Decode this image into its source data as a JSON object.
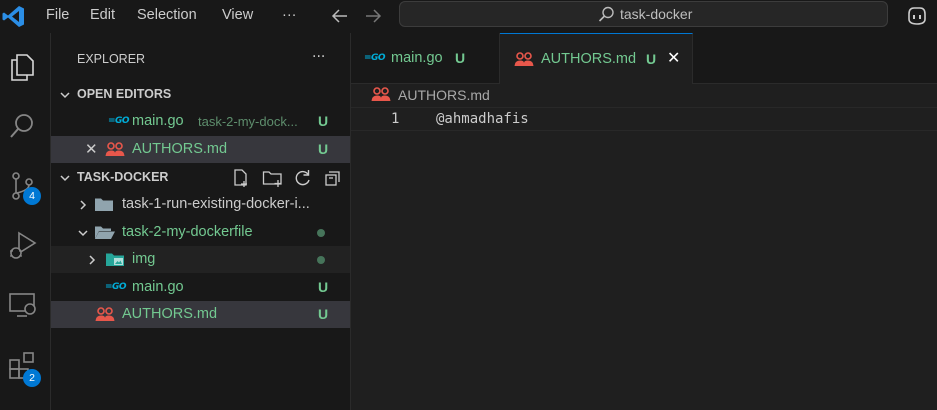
{
  "menu": {
    "file": "File",
    "edit": "Edit",
    "selection": "Selection",
    "view": "View",
    "more": "···"
  },
  "search": {
    "text": "task-docker"
  },
  "activity": {
    "source_control_badge": "4",
    "extensions_badge": "2"
  },
  "sidebar": {
    "title": "EXPLORER",
    "more": "···",
    "open_editors": {
      "label": "OPEN EDITORS",
      "items": [
        {
          "icon": "go-icon",
          "name": "main.go",
          "path": "task-2-my-dock...",
          "status": "U"
        },
        {
          "icon": "people-icon",
          "name": "AUTHORS.md",
          "status": "U",
          "close": "✕"
        }
      ]
    },
    "workspace": {
      "label": "TASK-DOCKER",
      "items": [
        {
          "type": "folder",
          "name": "task-1-run-existing-docker-i..."
        },
        {
          "type": "folder",
          "name": "task-2-my-dockerfile"
        },
        {
          "type": "folder",
          "name": "img"
        },
        {
          "type": "file",
          "name": "main.go",
          "status": "U"
        },
        {
          "type": "file",
          "name": "AUTHORS.md",
          "status": "U"
        }
      ]
    }
  },
  "tabs": [
    {
      "icon": "go-icon",
      "name": "main.go",
      "status": "U"
    },
    {
      "icon": "people-icon",
      "name": "AUTHORS.md",
      "status": "U",
      "close": "✕"
    }
  ],
  "go_glyph": "=GO",
  "breadcrumb": "AUTHORS.md",
  "code": [
    {
      "line": "1",
      "text": "@ahmadhafis"
    }
  ],
  "colors": {
    "accent": "#0078d4",
    "untracked": "#73c991",
    "people": "#e8574b",
    "go": "#00acd7"
  }
}
